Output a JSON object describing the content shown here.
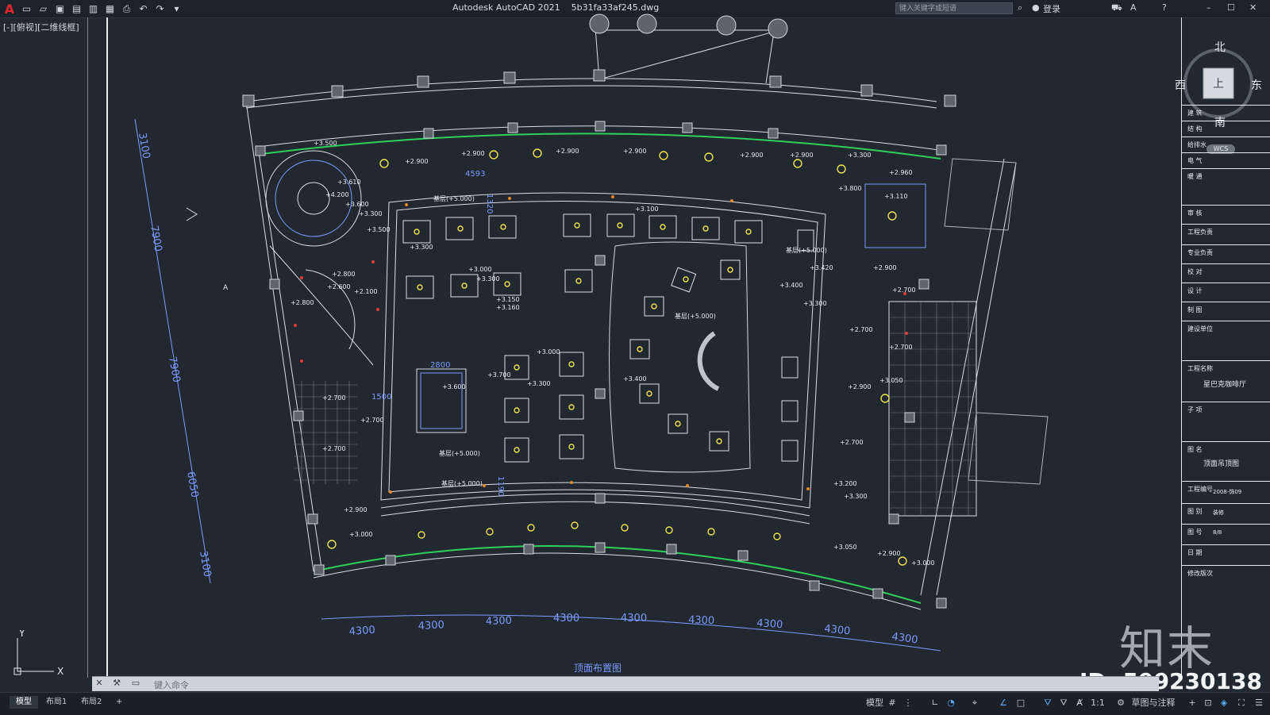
{
  "app": {
    "title": "Autodesk AutoCAD 2021",
    "file": "5b31fa33af245.dwg",
    "search_placeholder": "键入关键字或短语",
    "login_label": "登录"
  },
  "viewport": {
    "label": "[-][俯视][二维线框]"
  },
  "compass": {
    "north": "北",
    "south": "南",
    "east": "东",
    "west": "西",
    "top": "上",
    "wcs": "WCS"
  },
  "drawing": {
    "caption": "顶面布置图",
    "dims_bottom": [
      "4300",
      "4300",
      "4300",
      "4300",
      "4300",
      "4300",
      "4300",
      "4300",
      "4300"
    ],
    "dims_left": [
      "3100",
      "7900",
      "7900",
      "6050",
      "3100"
    ],
    "marker_a": "A",
    "elevations": [
      "+3.500",
      "+2.900",
      "+2.900",
      "+2.900",
      "+2.900",
      "+2.900",
      "+2.900",
      "+3.300",
      "+3.610",
      "+4.200",
      "+3.600",
      "+3.300",
      "+3.500",
      "+3.100",
      "+3.300",
      "+2.800",
      "+2.600",
      "+2.100",
      "+2.800",
      "+3.000",
      "+3.300",
      "+3.150",
      "+3.160",
      "+3.000",
      "+3.400",
      "+3.700",
      "+3.300",
      "+3.600",
      "+2.700",
      "+2.700",
      "+2.700",
      "+3.000",
      "+2.900",
      "+3.110",
      "+2.900",
      "+2.700",
      "+2.700",
      "+2.700",
      "+3.050",
      "+2.900",
      "+2.700",
      "+3.200",
      "+3.300",
      "+3.050",
      "+2.900",
      "+3.000",
      "+2.960",
      "+3.800",
      "+3.420",
      "+3.400",
      "+3.300"
    ],
    "dimension_small": [
      "4593",
      "2800",
      "1500",
      "1320",
      "1190"
    ],
    "notes": [
      "基层(+5.000)",
      "基层(+5.000)",
      "基层(+5.000)",
      "基层(+5.000)",
      "基层(+5.000)"
    ]
  },
  "titleblock": {
    "rows": [
      "建 筑",
      "结 构",
      "给排水",
      "电 气",
      "暖 通",
      "审 核",
      "工程负责",
      "专业负责",
      "校 对",
      "设 计",
      "制 图",
      "建设单位",
      "工程名称",
      "子 项",
      "图 名",
      "工程编号",
      "图 别",
      "图 号",
      "日 期",
      "修改版次"
    ],
    "project_name": "星巴克咖啡厅",
    "drawing_name": "顶面吊顶图",
    "project_no": "2008-饰09",
    "type": "装修",
    "number": "8/8"
  },
  "command": {
    "placeholder": "键入命令"
  },
  "tabs": [
    "模型",
    "布局1",
    "布局2"
  ],
  "status": {
    "model_label": "模型",
    "scale": "1:1",
    "workspace": "草图与注释"
  },
  "watermark": {
    "brand": "知末",
    "id": "ID: 599230138"
  },
  "ucs": {
    "x": "X",
    "y": "Y"
  }
}
